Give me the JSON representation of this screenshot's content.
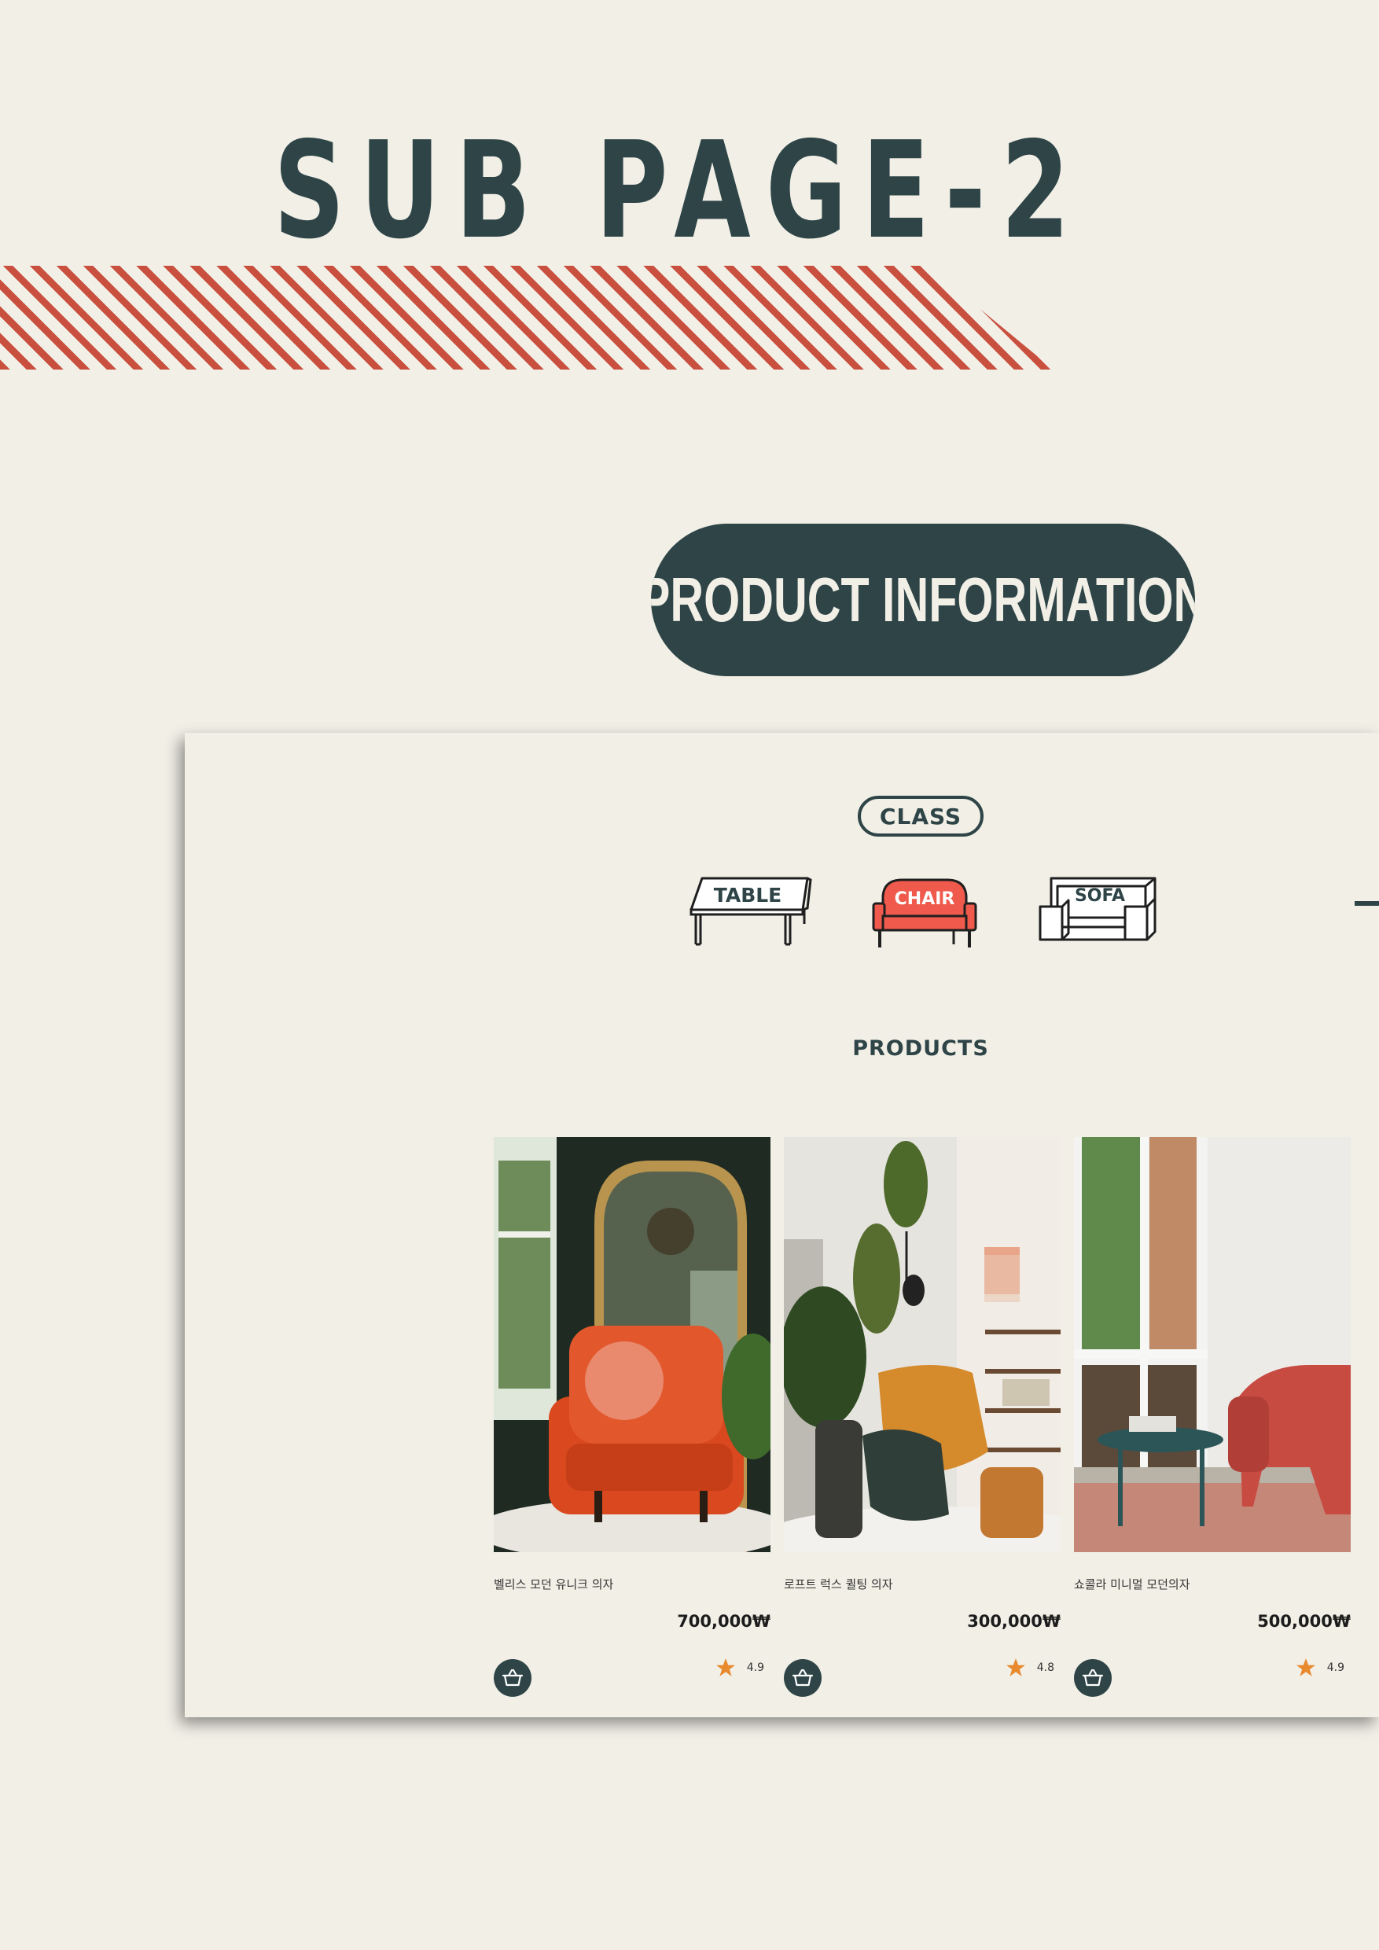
{
  "page_title": "SUB PAGE-2",
  "section_label": "PRODUCT INFORMATION",
  "class_label": "CLASS",
  "categories": [
    {
      "label": "TABLE",
      "active": false
    },
    {
      "label": "CHAIR",
      "active": true
    },
    {
      "label": "SOFA",
      "active": false
    }
  ],
  "products_heading": "PRODUCTS",
  "products": [
    {
      "name": "벨리스 모던 유니크 의자",
      "price": "700,000₩",
      "rating": "4.9"
    },
    {
      "name": "로프트 럭스 퀼팅 의자",
      "price": "300,000₩",
      "rating": "4.8"
    },
    {
      "name": "쇼콜라 미니멀 모던의자",
      "price": "500,000₩",
      "rating": "4.9"
    }
  ],
  "colors": {
    "background": "#f1efe6",
    "primary": "#2e4447",
    "accent": "#c9503f",
    "active_category": "#ef5a4c",
    "star": "#e8892e"
  },
  "icons": {
    "cart": "basket-icon",
    "rating": "star-icon"
  }
}
